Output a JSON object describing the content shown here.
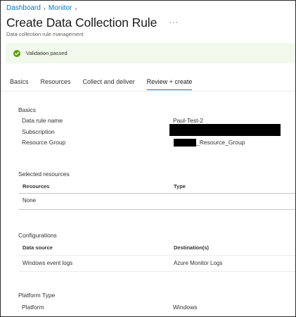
{
  "breadcrumb": [
    {
      "label": "Dashboard"
    },
    {
      "label": "Monitor"
    }
  ],
  "header": {
    "title": "Create Data Collection Rule",
    "more_label": "···",
    "subtitle": "Data collection rule management"
  },
  "banner": {
    "text": "Validation passed",
    "accent": "#57a300",
    "background": "#f1f9ec"
  },
  "tabs": [
    {
      "label": "Basics",
      "selected": false
    },
    {
      "label": "Resources",
      "selected": false
    },
    {
      "label": "Collect and deliver",
      "selected": false
    },
    {
      "label": "Review + create",
      "selected": true
    }
  ],
  "basics": {
    "heading": "Basics",
    "rows": [
      {
        "label": "Data rule name",
        "value": "Paul-Test-2"
      },
      {
        "label": "Subscription",
        "value": ""
      },
      {
        "label": "Resource Group",
        "value": "_Resource_Group"
      }
    ]
  },
  "selected_resources": {
    "heading": "Selected resources",
    "columns": [
      "Resources",
      "Type"
    ],
    "rows": [
      {
        "resources": "None",
        "type": ""
      }
    ]
  },
  "configurations": {
    "heading": "Configurations",
    "columns": [
      "Data source",
      "Destination(s)"
    ],
    "rows": [
      {
        "data_source": "Windows event logs",
        "destination": "Azure Monitor Logs"
      }
    ]
  },
  "platform": {
    "heading": "Platform Type",
    "label": "Platform",
    "value": "Windows"
  },
  "colors": {
    "link": "#0078d4",
    "text": "#323130",
    "success": "#57a300"
  }
}
